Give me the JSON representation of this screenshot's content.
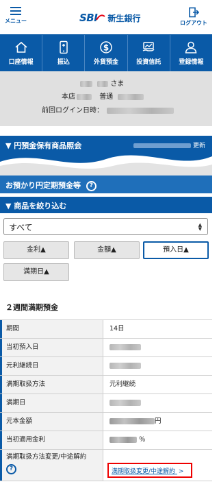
{
  "header": {
    "menu_label": "メニュー",
    "logo_text": "SBI",
    "bank_name": "新生銀行",
    "logout_label": "ログアウト"
  },
  "nav": {
    "items": [
      {
        "label": "口座情報",
        "icon": "house-icon"
      },
      {
        "label": "振込",
        "icon": "phone-transfer-icon"
      },
      {
        "label": "外貨預金",
        "icon": "dollar-icon"
      },
      {
        "label": "投資信託",
        "icon": "investment-icon"
      },
      {
        "label": "登録情報",
        "icon": "person-icon"
      }
    ]
  },
  "greeting": {
    "honorific": "さま",
    "branch_label": "本店",
    "account_type": "普通",
    "last_login_label": "前回ログイン日時："
  },
  "holdings": {
    "title": "▼ 円預金保有商品照会",
    "updated_suffix": "更新"
  },
  "deposits": {
    "title": "お預かり円定期預金等",
    "help": "?"
  },
  "filter": {
    "title": "▼ 商品を絞り込む",
    "selected": "すべて"
  },
  "sort": {
    "interest": "金利▲",
    "amount": "金額▲",
    "deposit_date": "預入日▲",
    "maturity": "満期日▲"
  },
  "product": {
    "title": "２週間満期預金",
    "rows": [
      {
        "key": "期間",
        "value": "14日"
      },
      {
        "key": "当初預入日",
        "value": ""
      },
      {
        "key": "元利継続日",
        "value": ""
      },
      {
        "key": "満期取扱方法",
        "value": "元利継続"
      },
      {
        "key": "満期日",
        "value": ""
      },
      {
        "key": "元本金額",
        "value": "円"
      },
      {
        "key": "当初適用金利",
        "value": "％"
      },
      {
        "key": "満期取扱方法変更/中途解約",
        "value": ""
      }
    ],
    "change_link": "満期取扱変更/中途解約",
    "help": "?"
  },
  "colors": {
    "brand_blue": "#0a5aa7",
    "highlight_red": "#ee0000"
  }
}
